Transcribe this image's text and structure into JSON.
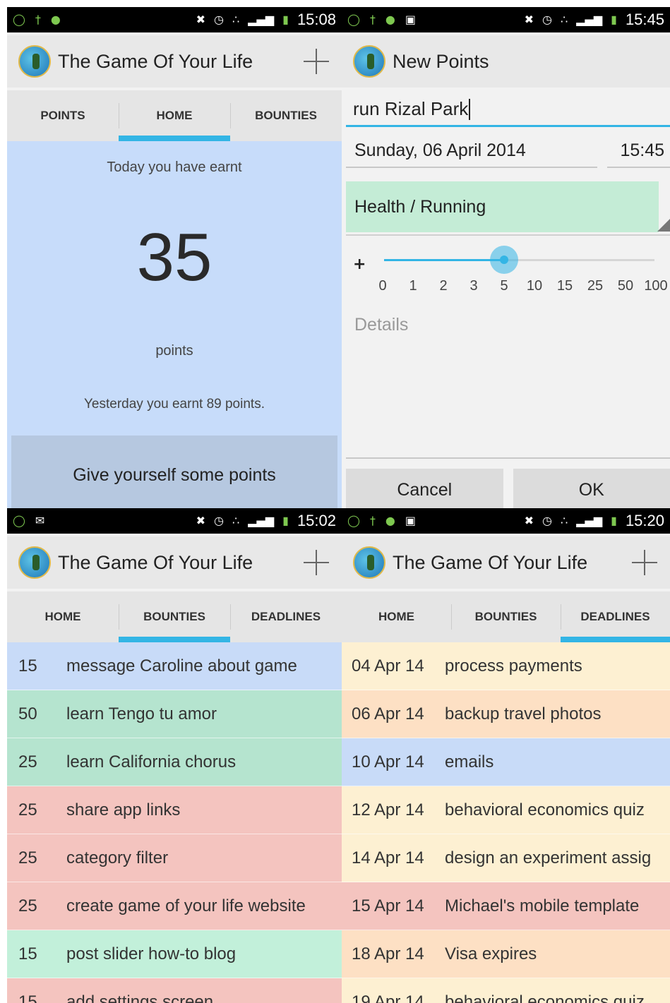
{
  "colors": {
    "accent": "#33b5e5",
    "blue": "#c7dcfa",
    "green": "#b5e4cf",
    "mint": "#c2f0da",
    "red": "#f4c4bf",
    "peach": "#fde0c4",
    "cream": "#fdf0d2",
    "row_blue": "#c8dbf8"
  },
  "icons": {
    "status_left": [
      "check-circle-icon",
      "usb-icon",
      "android-icon",
      "image-icon",
      "mail-icon"
    ],
    "status_right": [
      "mute-icon",
      "alarm-icon",
      "wifi-icon",
      "signal-icon",
      "battery-icon"
    ],
    "app": "surfer-logo-icon",
    "add": "plus-icon"
  },
  "home_panel": {
    "status_time": "15:08",
    "title": "The Game Of Your Life",
    "tabs": [
      {
        "label": "POINTS",
        "active": false
      },
      {
        "label": "HOME",
        "active": true
      },
      {
        "label": "BOUNTIES",
        "active": false
      }
    ],
    "today_label": "Today you have earnt",
    "points": "35",
    "points_label": "points",
    "yesterday_text": "Yesterday you earnt 89 points.",
    "give_button": "Give yourself some points"
  },
  "new_points_panel": {
    "status_time": "15:45",
    "title": "New Points",
    "name_value": "run Rizal Park",
    "date_value": "Sunday, 06 April 2014",
    "time_value": "15:45",
    "category": "Health / Running",
    "slider_plus": "+",
    "slider_ticks": [
      "0",
      "1",
      "2",
      "3",
      "5",
      "10",
      "15",
      "25",
      "50",
      "100"
    ],
    "slider_value": "5",
    "details_placeholder": "Details",
    "cancel_label": "Cancel",
    "ok_label": "OK"
  },
  "bounties_panel": {
    "status_time": "15:02",
    "title": "The Game Of Your Life",
    "tabs": [
      {
        "label": "HOME",
        "active": false
      },
      {
        "label": "BOUNTIES",
        "active": true
      },
      {
        "label": "DEADLINES",
        "active": false
      }
    ],
    "items": [
      {
        "points": "15",
        "text": "message Caroline about game",
        "color": "#c8dbf8"
      },
      {
        "points": "50",
        "text": "learn Tengo tu amor",
        "color": "#b5e4cf"
      },
      {
        "points": "25",
        "text": "learn California chorus",
        "color": "#b5e4cf"
      },
      {
        "points": "25",
        "text": "share app links",
        "color": "#f4c4bf"
      },
      {
        "points": "25",
        "text": "category filter",
        "color": "#f4c4bf"
      },
      {
        "points": "25",
        "text": "create game of your life website",
        "color": "#f4c4bf"
      },
      {
        "points": "15",
        "text": "post slider how-to blog",
        "color": "#c2f0da"
      },
      {
        "points": "15",
        "text": "add settings screen",
        "color": "#f4c4bf"
      }
    ]
  },
  "deadlines_panel": {
    "status_time": "15:20",
    "title": "The Game Of Your Life",
    "tabs": [
      {
        "label": "HOME",
        "active": false
      },
      {
        "label": "BOUNTIES",
        "active": false
      },
      {
        "label": "DEADLINES",
        "active": true
      }
    ],
    "items": [
      {
        "date": "04 Apr 14",
        "text": "process payments",
        "color": "#fdf0d2"
      },
      {
        "date": "06 Apr 14",
        "text": "backup travel photos",
        "color": "#fde0c4"
      },
      {
        "date": "10 Apr 14",
        "text": "emails",
        "color": "#c8dbf8"
      },
      {
        "date": "12 Apr 14",
        "text": "behavioral economics quiz",
        "color": "#fdf0d2"
      },
      {
        "date": "14 Apr 14",
        "text": "design an experiment assiɡ",
        "color": "#fdf0d2"
      },
      {
        "date": "15 Apr 14",
        "text": "Michael's mobile template",
        "color": "#f4c4bf"
      },
      {
        "date": "18 Apr 14",
        "text": "Visa expires",
        "color": "#fde0c4"
      },
      {
        "date": "19 Apr 14",
        "text": "behavioral economics quiz",
        "color": "#fdf0d2"
      }
    ]
  }
}
